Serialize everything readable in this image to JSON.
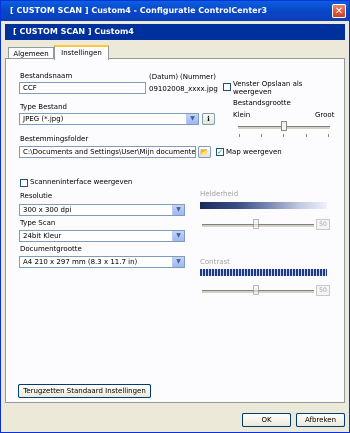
{
  "window": {
    "title": "[  CUSTOM SCAN  ]  Custom4 - Configuratie ControlCenter3",
    "close_glyph": "✕"
  },
  "banner": {
    "title": "[  CUSTOM SCAN  ]    Custom4"
  },
  "tabs": [
    {
      "label": "Algemeen",
      "active": false
    },
    {
      "label": "Instellingen",
      "active": true
    }
  ],
  "settings": {
    "filename_label": "Bestandsnaam",
    "filename_value": "CCF",
    "date_label": "(Datum)",
    "number_label": "(Nummer)",
    "example_name": "09102008_xxxx.jpg",
    "show_save_window_label": "Venster Opslaan als weergeven",
    "filesize_label": "Bestandsgrootte",
    "filesize_small": "Klein",
    "filesize_large": "Groot",
    "filesize_level": 0.5,
    "filetype_label": "Type Bestand",
    "filetype_value": "JPEG (*.jpg)",
    "destination_label": "Bestemmingsfolder",
    "destination_value": "C:\\Documents and Settings\\User\\Mijn documenten\\M",
    "show_folder_label": "Map weergeven",
    "show_folder_checked": true,
    "show_folder_check_glyph": "✓"
  },
  "scan": {
    "scanner_interface_label": "Scanneninterface weergeven",
    "resolution_label": "Resolutie",
    "resolution_value": "300 x 300 dpi",
    "scan_type_label": "Type Scan",
    "scan_type_value": "24bit Kleur",
    "doc_size_label": "Documentgrootte",
    "doc_size_value": "A4 210 x 297 mm (8.3 x 11.7 in)",
    "brightness_label": "Helderheid",
    "brightness_value": "50",
    "contrast_label": "Contrast",
    "contrast_value": "50"
  },
  "buttons": {
    "restore_defaults": "Terugzetten Standaard Instellingen",
    "ok": "OK",
    "cancel": "Afbreken"
  },
  "icons": {
    "combo_arrow": "▼",
    "info": "ℹ",
    "folder": "📂"
  }
}
